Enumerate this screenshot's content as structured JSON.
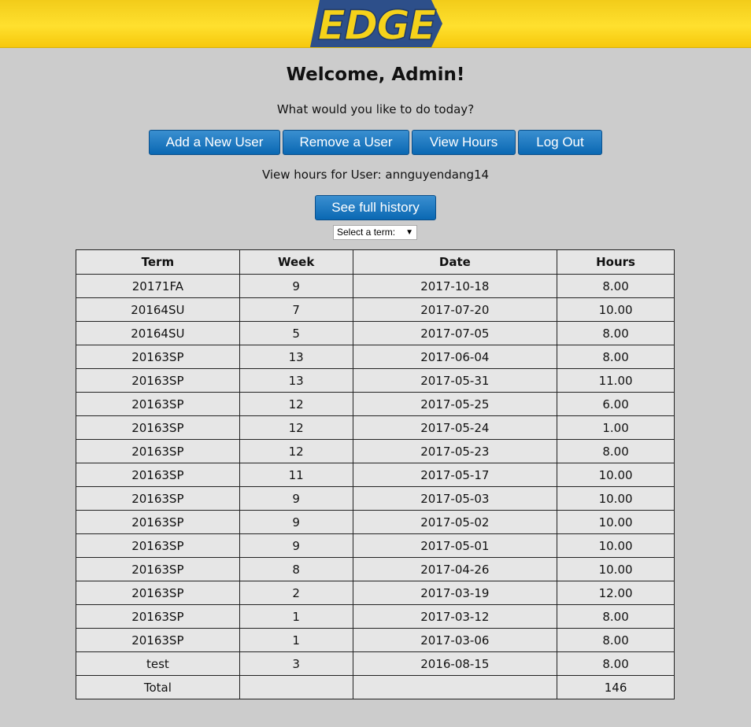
{
  "header": {
    "logo_text": "EDGE",
    "colors": {
      "bar": "#ffd81c",
      "logo_fill": "#f5d21a",
      "logo_outline": "#2d4f8a"
    }
  },
  "main": {
    "title": "Welcome, Admin!",
    "prompt": "What would you like to do today?",
    "actions": {
      "add_user": "Add a New User",
      "remove_user": "Remove a User",
      "view_hours": "View Hours",
      "log_out": "Log Out"
    },
    "view_hours_label": "View hours for User: annguyendang14",
    "full_history_button": "See full history",
    "term_select": {
      "selected": "Select a term:"
    }
  },
  "table": {
    "columns": [
      "Term",
      "Week",
      "Date",
      "Hours"
    ],
    "rows": [
      [
        "20171FA",
        "9",
        "2017-10-18",
        "8.00"
      ],
      [
        "20164SU",
        "7",
        "2017-07-20",
        "10.00"
      ],
      [
        "20164SU",
        "5",
        "2017-07-05",
        "8.00"
      ],
      [
        "20163SP",
        "13",
        "2017-06-04",
        "8.00"
      ],
      [
        "20163SP",
        "13",
        "2017-05-31",
        "11.00"
      ],
      [
        "20163SP",
        "12",
        "2017-05-25",
        "6.00"
      ],
      [
        "20163SP",
        "12",
        "2017-05-24",
        "1.00"
      ],
      [
        "20163SP",
        "12",
        "2017-05-23",
        "8.00"
      ],
      [
        "20163SP",
        "11",
        "2017-05-17",
        "10.00"
      ],
      [
        "20163SP",
        "9",
        "2017-05-03",
        "10.00"
      ],
      [
        "20163SP",
        "9",
        "2017-05-02",
        "10.00"
      ],
      [
        "20163SP",
        "9",
        "2017-05-01",
        "10.00"
      ],
      [
        "20163SP",
        "8",
        "2017-04-26",
        "10.00"
      ],
      [
        "20163SP",
        "2",
        "2017-03-19",
        "12.00"
      ],
      [
        "20163SP",
        "1",
        "2017-03-12",
        "8.00"
      ],
      [
        "20163SP",
        "1",
        "2017-03-06",
        "8.00"
      ],
      [
        "test",
        "3",
        "2016-08-15",
        "8.00"
      ]
    ],
    "total": {
      "label": "Total",
      "week": "",
      "date": "",
      "hours": "146"
    }
  },
  "theme": {
    "background": "#cccccc",
    "button": "#0a68b3",
    "table_bg": "#e6e6e6"
  }
}
